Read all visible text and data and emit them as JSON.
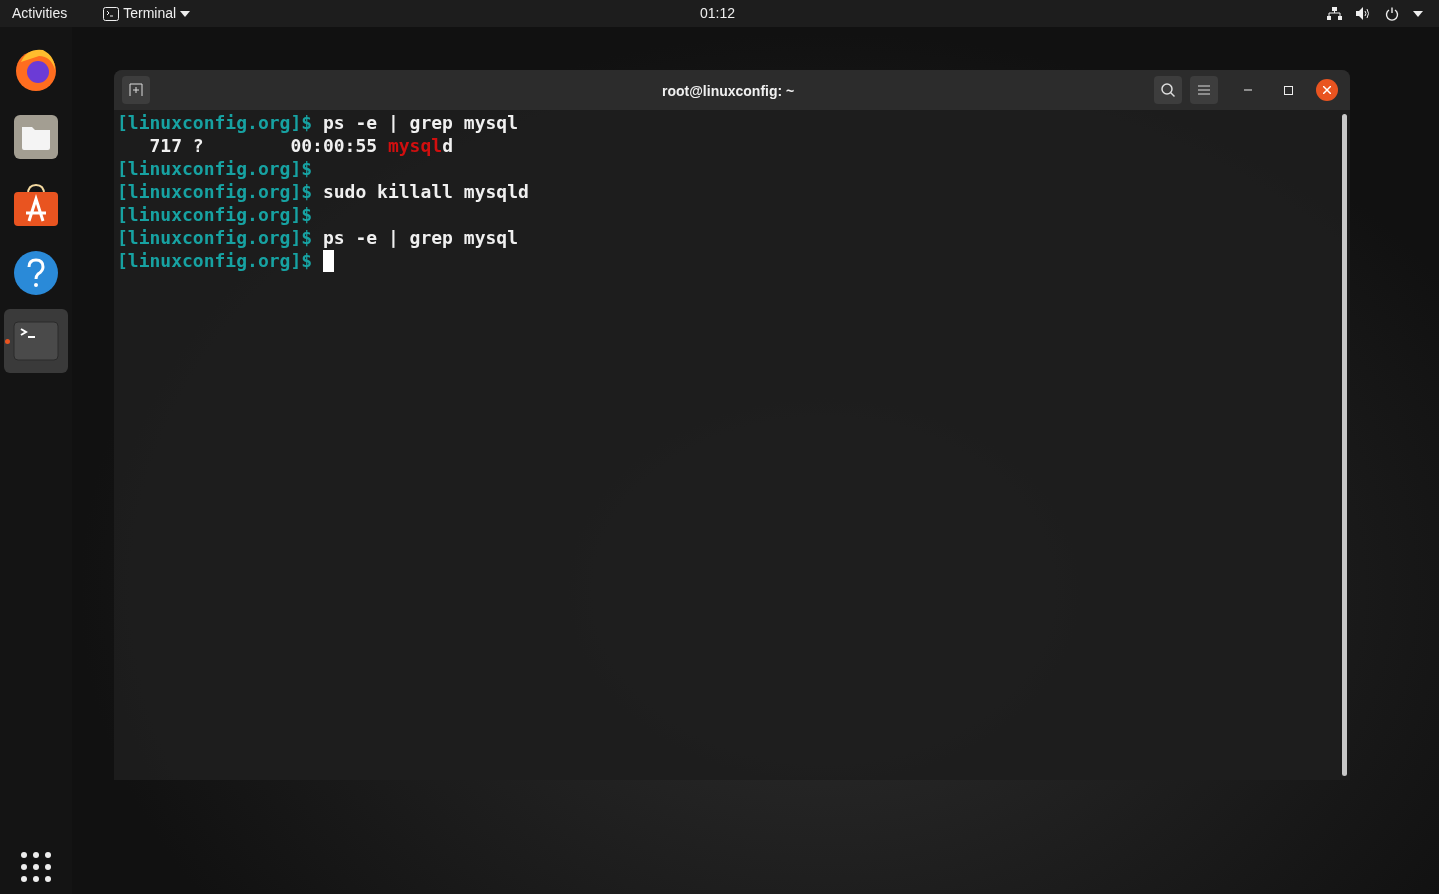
{
  "top_bar": {
    "activities": "Activities",
    "app_menu": "Terminal",
    "clock": "01:12"
  },
  "dock": {
    "items": [
      {
        "kind": "firefox",
        "running": false
      },
      {
        "kind": "files",
        "running": false
      },
      {
        "kind": "software",
        "running": false
      },
      {
        "kind": "help",
        "running": false
      },
      {
        "kind": "terminal",
        "running": true
      }
    ]
  },
  "window": {
    "title": "root@linuxconfig: ~",
    "lines": [
      {
        "segments": [
          {
            "kind": "prompt",
            "text": "[linuxconfig.org]$"
          },
          {
            "kind": "input",
            "text": " ps -e | grep mysql"
          }
        ]
      },
      {
        "segments": [
          {
            "kind": "input",
            "text": "   717 ?        00:00:55 "
          },
          {
            "kind": "match",
            "text": "mysql"
          },
          {
            "kind": "input",
            "text": "d"
          }
        ]
      },
      {
        "segments": [
          {
            "kind": "prompt",
            "text": "[linuxconfig.org]$"
          }
        ]
      },
      {
        "segments": [
          {
            "kind": "prompt",
            "text": "[linuxconfig.org]$"
          },
          {
            "kind": "input",
            "text": " sudo killall mysqld"
          }
        ]
      },
      {
        "segments": [
          {
            "kind": "prompt",
            "text": "[linuxconfig.org]$"
          }
        ]
      },
      {
        "segments": [
          {
            "kind": "prompt",
            "text": "[linuxconfig.org]$"
          },
          {
            "kind": "input",
            "text": " ps -e | grep mysql"
          }
        ]
      },
      {
        "segments": [
          {
            "kind": "prompt",
            "text": "[linuxconfig.org]$"
          }
        ],
        "cursor": true
      }
    ]
  }
}
